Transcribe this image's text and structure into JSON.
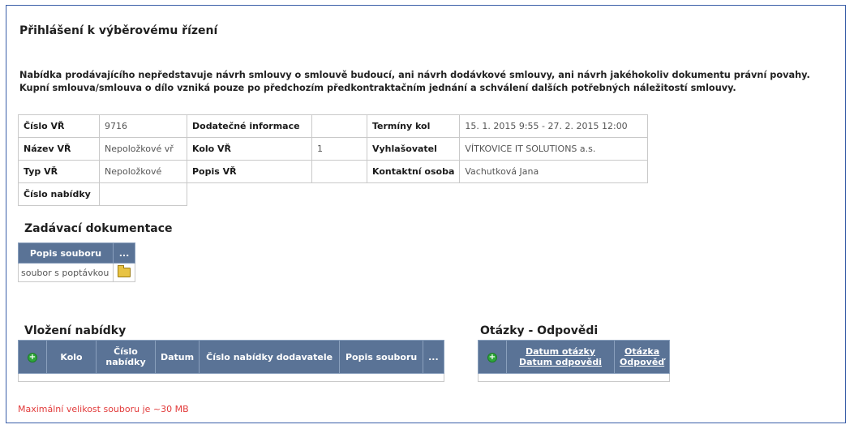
{
  "title": "Přihlášení k výběrovému řízení",
  "notice": {
    "line1": "Nabídka prodávajícího nepředstavuje návrh smlouvy o smlouvě budoucí, ani návrh dodávkové smlouvy, ani návrh jakéhokoliv dokumentu právní povahy.",
    "line2": "Kupní smlouva/smlouva o dílo vzniká pouze po předchozím předkontraktačním jednání a schválení dalších potřebných náležitostí smlouvy."
  },
  "info": {
    "cislo_vr": {
      "label": "Číslo VŘ",
      "value": "9716"
    },
    "nazev_vr": {
      "label": "Název VŘ",
      "value": "Nepoložkové vř"
    },
    "typ_vr": {
      "label": "Typ VŘ",
      "value": "Nepoložkové"
    },
    "cislo_nabidky": {
      "label": "Číslo nabídky",
      "value": ""
    },
    "dodatecne": {
      "label": "Dodatečné informace",
      "value": ""
    },
    "kolo_vr": {
      "label": "Kolo VŘ",
      "value": "1"
    },
    "popis_vr": {
      "label": "Popis VŘ",
      "value": ""
    },
    "terminy": {
      "label": "Termíny kol",
      "value": "15. 1. 2015 9:55 - 27. 2. 2015 12:00"
    },
    "vyhlasovatel": {
      "label": "Vyhlašovatel",
      "value": "VÍTKOVICE IT SOLUTIONS a.s."
    },
    "kontakt": {
      "label": "Kontaktní osoba",
      "value": "Vachutková Jana"
    }
  },
  "docs": {
    "title": "Zadávací dokumentace",
    "col_popis": "Popis souboru",
    "col_more": "...",
    "rows": [
      {
        "popis": "soubor s poptávkou",
        "icon": "open-folder-icon"
      }
    ]
  },
  "offers": {
    "title": "Vložení nabídky",
    "add_icon": "add-icon",
    "col_kolo": "Kolo",
    "col_cislo": "Číslo nabídky",
    "col_datum": "Datum",
    "col_cislo_dod": "Číslo nabídky dodavatele",
    "col_popis": "Popis souboru",
    "col_more": "..."
  },
  "qa": {
    "title": "Otázky - Odpovědi",
    "add_icon": "add-icon",
    "col_datum_otazky": "Datum otázky",
    "col_datum_odpovedi": "Datum odpovědi",
    "col_otazka": "Otázka",
    "col_odpoved": "Odpověď"
  },
  "max_size": "Maximální velikost souboru je ~30 MB",
  "colors": {
    "header_bg": "#5a7396",
    "frame_border": "#3a5fa8",
    "warning_text": "#e23b3b",
    "add_green": "#2ea63a"
  }
}
